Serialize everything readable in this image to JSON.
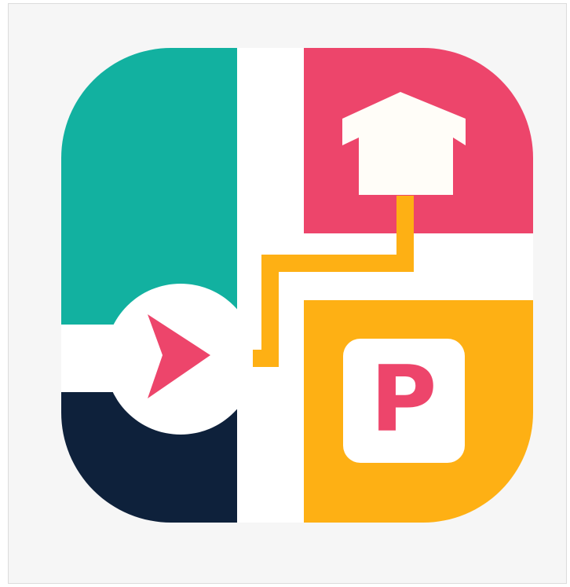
{
  "app_icon": {
    "icon_name": "parking-navigation-app-icon",
    "parking_label": "P",
    "colors": {
      "frame_background": "#f6f6f6",
      "frame_border": "#dcdcdc",
      "teal": "#12b1a0",
      "pink": "#ed456b",
      "navy": "#0e213b",
      "amber": "#feb014",
      "white": "#ffffff",
      "house": "#fffdf8"
    },
    "elements": {
      "start_marker": "play-arrow-icon",
      "destination_marker": "house-icon",
      "route": "route-path",
      "parking_sign": "parking-sign-icon"
    }
  }
}
